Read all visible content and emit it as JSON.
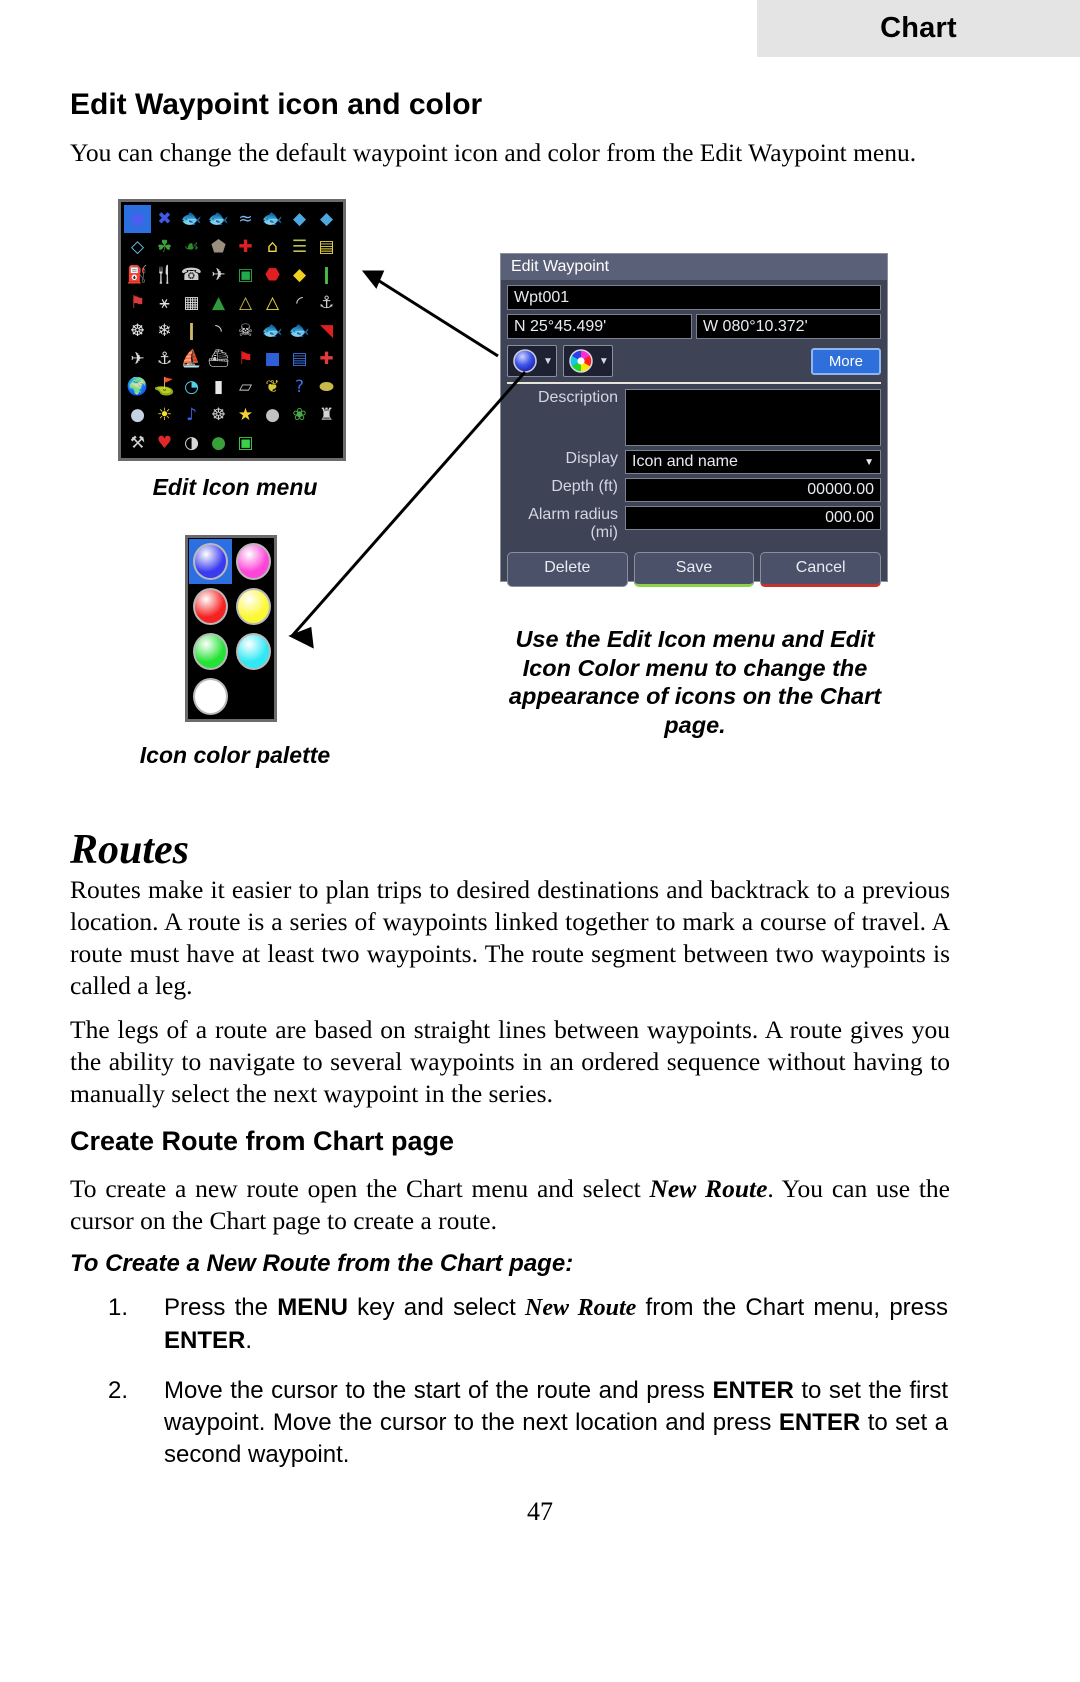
{
  "header": {
    "tab_label": "Chart"
  },
  "section": {
    "heading": "Edit Waypoint icon and color",
    "intro": "You can change the default waypoint icon and color from the Edit Waypoint menu."
  },
  "figures": {
    "icon_menu_caption": "Edit Icon menu",
    "palette_caption": "Icon color palette",
    "right_caption": "Use the Edit Icon menu and Edit Icon Color menu to change the appearance of icons on the Chart page."
  },
  "icon_menu": {
    "columns": 8,
    "rows": 9,
    "selected_index": 0,
    "icons": [
      "blue-sphere-icon",
      "blue-x-icon",
      "red-fish-icon",
      "green-fish-icon",
      "fish-school-icon",
      "trout-icon",
      "blue-diamond-marker-icon",
      "blue-diamond-marker-2-icon",
      "blue-diamond-icon",
      "grass-icon",
      "reeds-icon",
      "rock-icon",
      "red-cross-icon",
      "yellow-house-icon",
      "submarine-icon",
      "store-icon",
      "fuel-pump-icon",
      "fork-knife-icon",
      "phone-icon",
      "airplane-icon",
      "exit-sign-icon",
      "stop-sign-icon",
      "yellow-warning-icon",
      "traffic-light-icon",
      "us-flag-icon",
      "pedestrian-icon",
      "restroom-icon",
      "evergreen-tree-icon",
      "mountain-icon",
      "tent-icon",
      "bridge-icon",
      "waterski-icon",
      "footprints-icon",
      "bird-tracks-icon",
      "road-icon",
      "car-icon",
      "skull-crossbones-icon",
      "fish-icon",
      "small-fish-icon",
      "dive-flag-icon",
      "seaplane-icon",
      "anchor-icon",
      "boat-icon",
      "ferry-icon",
      "racing-flag-icon",
      "dock-icon",
      "marina-icon",
      "first-aid-boat-icon",
      "globe-icon",
      "flag-hill-icon",
      "diving-mask-icon",
      "lighthouse-icon",
      "banner-icon",
      "balloons-icon",
      "question-mark-icon",
      "sandbag-icon",
      "diver-helmet-icon",
      "sun-icon",
      "music-note-icon",
      "crab-icon",
      "star-icon",
      "grenade-icon",
      "wreath-icon",
      "trophy-icon",
      "tools-icon",
      "heart-icon",
      "wreck-icon",
      "lilypad-icon",
      "exit-green-icon"
    ]
  },
  "color_palette": {
    "selected_index": 0,
    "colors": [
      "#3a3af0",
      "#ff44d8",
      "#f52222",
      "#fdf834",
      "#25e236",
      "#2fe8f4",
      "#ffffff"
    ]
  },
  "dialog": {
    "title": "Edit Waypoint",
    "name_value": "Wpt001",
    "lat_value": "N 25°45.499'",
    "lon_value": "W 080°10.372'",
    "icon_button_name": "waypoint-icon-selector",
    "color_button_name": "waypoint-color-selector",
    "more_label": "More",
    "fields": [
      {
        "label": "Description",
        "value": "",
        "type": "textarea"
      },
      {
        "label": "Display",
        "value": "Icon and name",
        "type": "select"
      },
      {
        "label": "Depth (ft)",
        "value": "00000.00",
        "type": "number"
      },
      {
        "label": "Alarm radius (mi)",
        "value": "000.00",
        "type": "number"
      }
    ],
    "buttons": [
      {
        "label": "Delete",
        "accent": ""
      },
      {
        "label": "Save",
        "accent": "#8dd24a"
      },
      {
        "label": "Cancel",
        "accent": "#c43232"
      }
    ]
  },
  "routes": {
    "heading": "Routes",
    "p1": "Routes make it easier to plan trips to desired destinations and backtrack to a previous location. A route is a series of waypoints linked together to mark a course of travel. A route must have at least two waypoints. The route segment between two waypoints is called a leg.",
    "p2": "The legs of a route are based on straight lines between waypoints. A route gives you the ability to navigate to several waypoints in an ordered sequence without having to manually select the next waypoint in the series.",
    "create_heading": "Create Route from Chart page",
    "p3_a": "To create a new route open the Chart menu and select ",
    "p3_em": "New Route",
    "p3_b": ". You can use the cursor on the Chart page to create a route.",
    "sub_heading": "To Create a New Route from the Chart page:",
    "steps": [
      {
        "num": "1.",
        "a": "Press the ",
        "k1": "MENU",
        "b": " key and select ",
        "em": "New Route",
        "c": " from the Chart menu, press ",
        "k2": "ENTER",
        "d": "."
      },
      {
        "num": "2.",
        "a": "Move the cursor to the start of the route and press ",
        "k1": "ENTER",
        "b": " to set the first waypoint. Move the cursor to the next location and press ",
        "k2": "ENTER",
        "c": " to set a second waypoint."
      }
    ]
  },
  "page_number": "47"
}
